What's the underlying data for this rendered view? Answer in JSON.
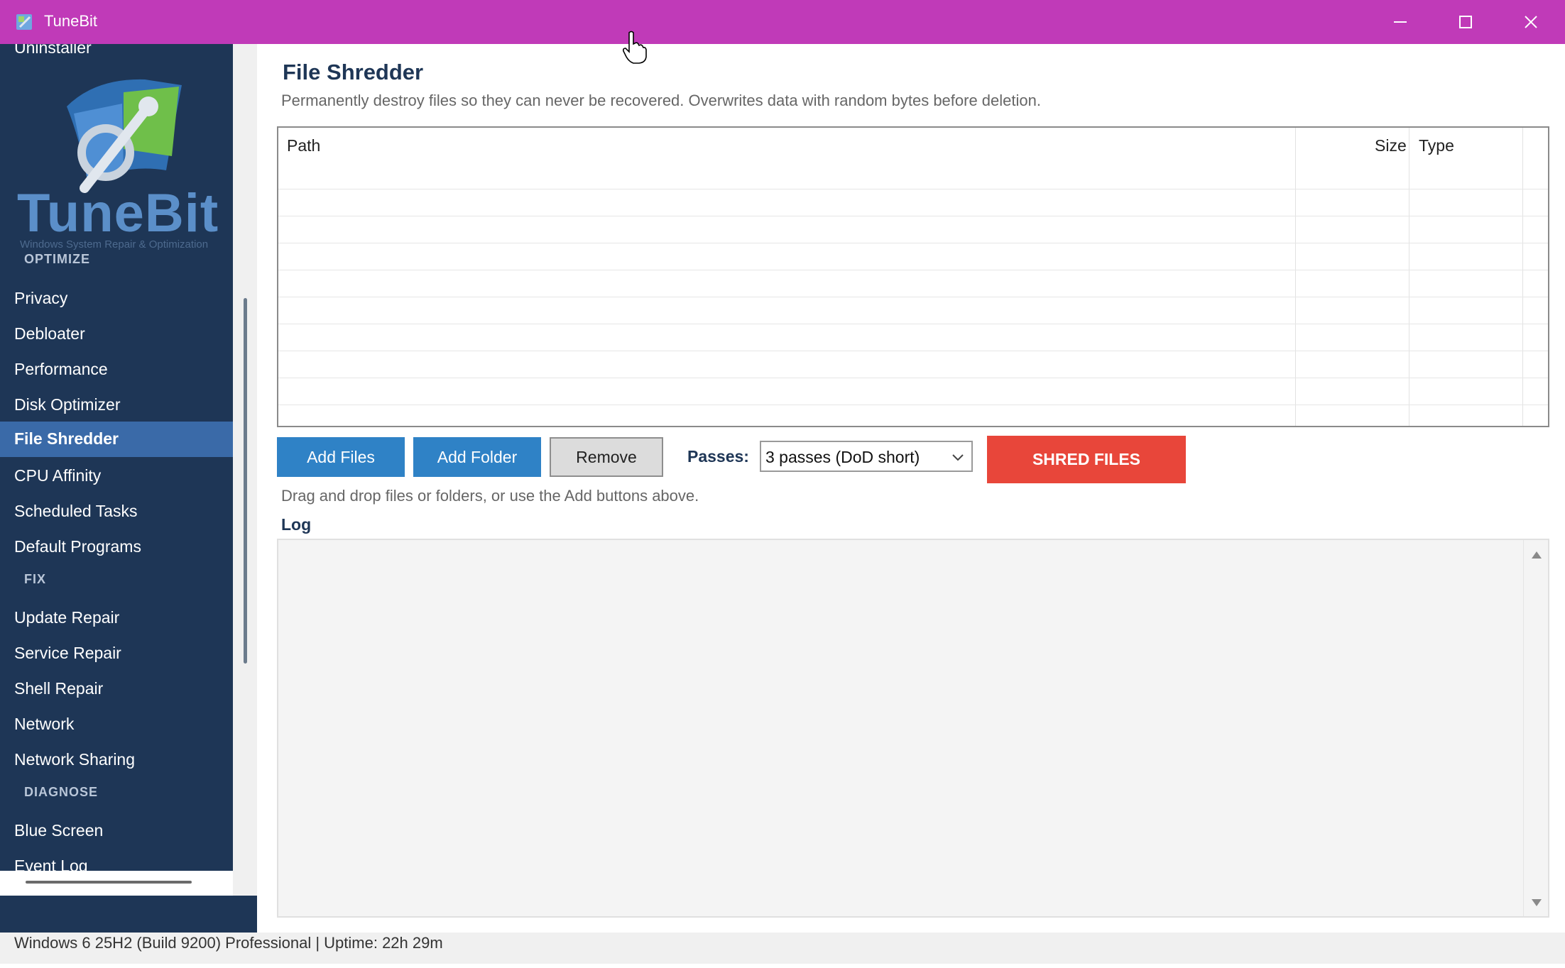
{
  "window": {
    "title": "TuneBit",
    "accent_color": "#c03ab8"
  },
  "sidebar": {
    "cut_item": "Uninstaller",
    "logo_text": "TuneBit",
    "logo_subtitle": "Windows System Repair & Optimization",
    "sections": {
      "optimize": "OPTIMIZE",
      "fix": "FIX",
      "diagnose": "DIAGNOSE"
    },
    "optimize_items": [
      "Privacy",
      "Debloater",
      "Performance",
      "Disk Optimizer",
      "File Shredder",
      "CPU Affinity",
      "Scheduled Tasks",
      "Default Programs"
    ],
    "fix_items": [
      "Update Repair",
      "Service Repair",
      "Shell Repair",
      "Network",
      "Network Sharing"
    ],
    "diagnose_items": [
      "Blue Screen",
      "Event Log"
    ],
    "active_item": "File Shredder"
  },
  "main": {
    "title": "File Shredder",
    "description": "Permanently destroy files so they can never be recovered. Overwrites data with random bytes before deletion.",
    "columns": [
      "Path",
      "Size",
      "Type"
    ],
    "rows": [],
    "buttons": {
      "add_files": "Add Files",
      "add_folder": "Add Folder",
      "remove": "Remove",
      "shred": "SHRED FILES"
    },
    "passes_label": "Passes:",
    "passes_value": "3 passes (DoD short)",
    "hint": "Drag and drop files or folders, or use the Add buttons above.",
    "log_label": "Log",
    "log_text": ""
  },
  "status": {
    "text": "Windows 6 25H2 (Build 9200) Professional  |  Uptime: 22h 29m"
  },
  "colors": {
    "sidebar_bg": "#1e3656",
    "active_item_bg": "#3a6aa8",
    "button_blue": "#2f82c6",
    "shred_red": "#e8463a"
  },
  "icons": [
    "app-icon",
    "minimize-icon",
    "maximize-icon",
    "close-icon",
    "chevron-down-icon",
    "scroll-up-icon",
    "scroll-down-icon",
    "cursor-hand-icon"
  ]
}
